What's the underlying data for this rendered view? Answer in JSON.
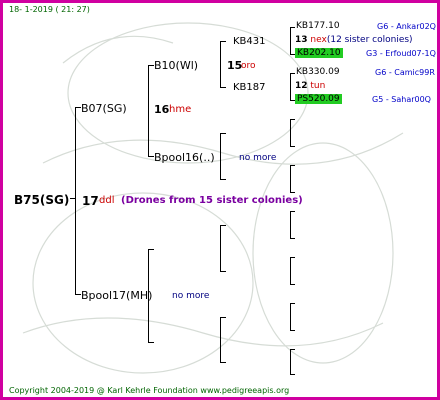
{
  "header": {
    "date": "18-  1-2019 ( 21: 27)"
  },
  "footer": {
    "copyright": "Copyright 2004-2019 @ Karl Kehrle Foundation   www.pedigreeapis.org"
  },
  "colors": {
    "border": "#d000a0",
    "highlight": "#22cc22",
    "gen_text": "#0000c8",
    "red_text": "#cc0000",
    "purple_text": "#7a00a0"
  },
  "root": {
    "label": "B75(SG)",
    "drones": "17",
    "drones_suffix": "ddl",
    "note": "(Drones from 15 sister colonies)"
  },
  "gen1": {
    "upper": {
      "label": "B07(SG)",
      "drones": "16",
      "drones_suffix": "hme"
    },
    "lower": {
      "label": "Bpool17(MH)",
      "note": "no more"
    }
  },
  "gen2": {
    "upper": {
      "label": "B10(Wl)",
      "drones": "15",
      "drones_suffix": "oro"
    },
    "lower": {
      "label": "Bpool16(..)",
      "note": "no more"
    }
  },
  "gen3": {
    "upper": {
      "label": "KB431",
      "drones": "13",
      "drones_suffix": "nex",
      "drones_note": "(12 sister colonies)"
    },
    "lower": {
      "label": "KB187",
      "drones": "12",
      "drones_suffix": "tun"
    }
  },
  "gen4": [
    {
      "label": "KB177.10",
      "gen": "G6 - Ankar02Q",
      "highlight": false
    },
    {
      "label": "KB202.10",
      "gen": "G3 - Erfoud07-1Q",
      "highlight": true
    },
    {
      "label": "KB330.09",
      "gen": "G6 - Camic99R",
      "highlight": false
    },
    {
      "label": "PS520.09",
      "gen": "G5 - Sahar00Q",
      "highlight": true
    }
  ]
}
